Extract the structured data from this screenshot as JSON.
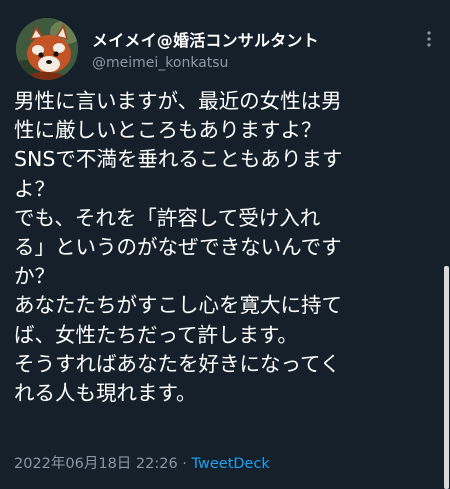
{
  "tweet": {
    "author": {
      "display_name": "メイメイ@婚活コンサルタント",
      "handle": "@meimei_konkatsu",
      "avatar_icon": "red-panda-avatar"
    },
    "more_icon": "more-options-icon",
    "lines": [
      "男性に言いますが、最近の女性は男",
      "性に厳しいところもありますよ？",
      "SNSで不満を垂れることもあります",
      "よ？",
      "でも、それを「許容して受け入れ",
      "る」というのがなぜできないんです",
      "か？",
      "あなたたちがすこし心を寛大に持て",
      "ば、女性たちだって許します。",
      "そうすればあなたを好きになってく",
      "れる人も現れます。"
    ],
    "timestamp": "2022年06月18日 22:26",
    "separator": " · ",
    "source": "TweetDeck"
  },
  "colors": {
    "background": "#15202b",
    "text": "#ffffff",
    "secondary": "#8899a6",
    "link": "#1da1f2"
  }
}
